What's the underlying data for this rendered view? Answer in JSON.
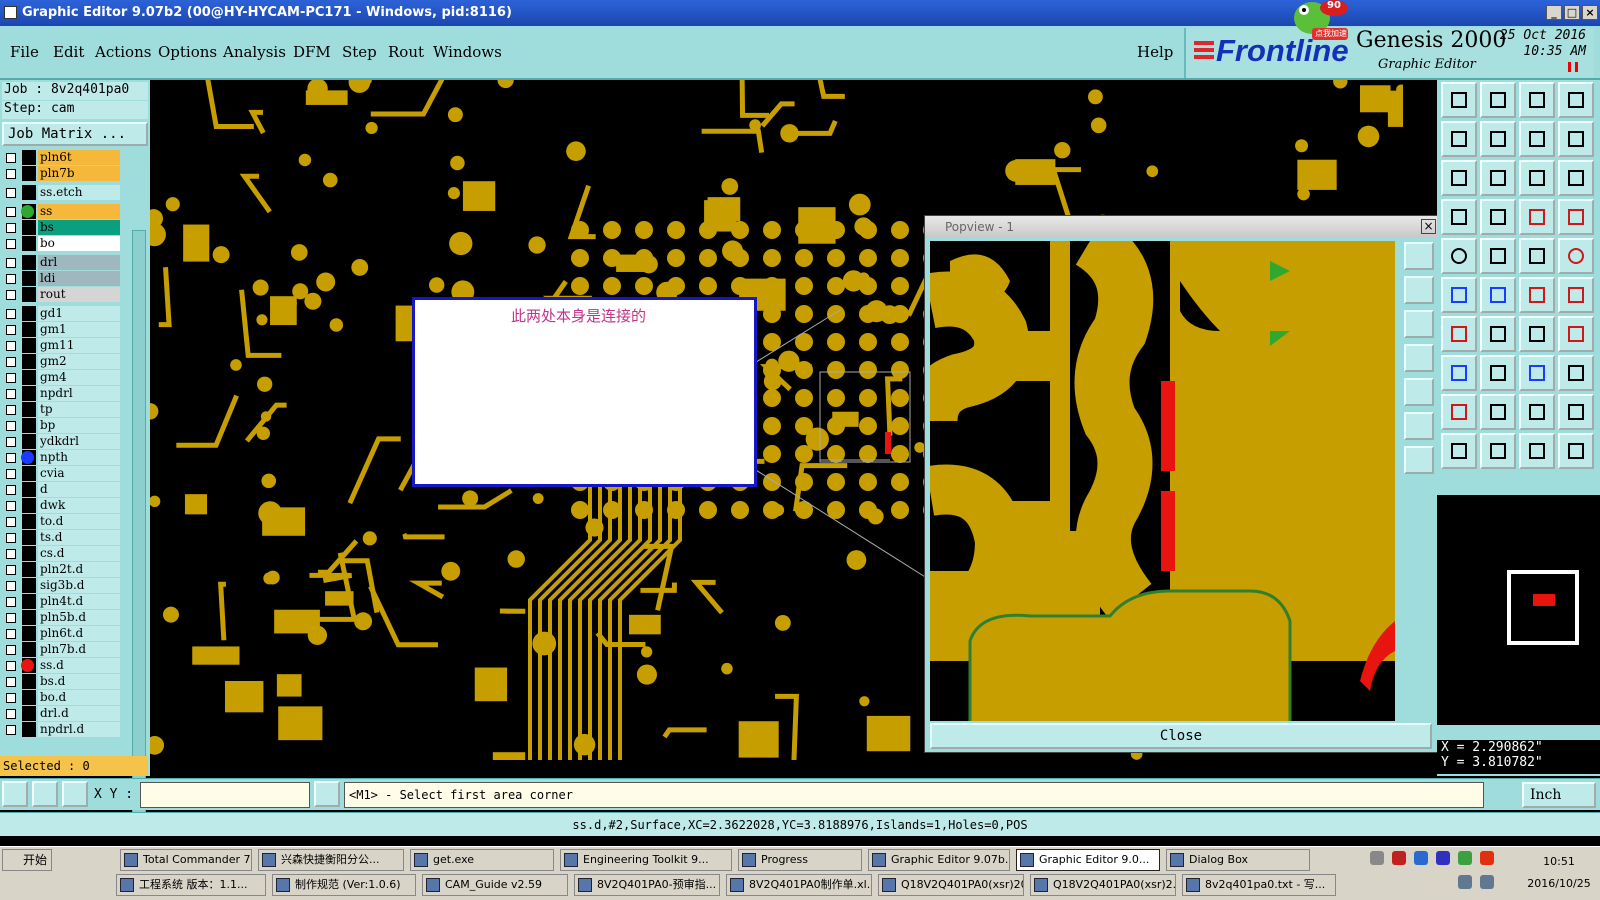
{
  "window": {
    "title": "Graphic Editor 9.07b2 (00@HY-HYCAM-PC171 - Windows, pid:8116)"
  },
  "menu": [
    "File",
    "Edit",
    "Actions",
    "Options",
    "Analysis",
    "DFM",
    "Step",
    "Rout",
    "Windows"
  ],
  "help": "Help",
  "brand": {
    "logo": "Frontline",
    "product": "Genesis 2000",
    "subtitle": "Graphic Editor",
    "date": "25 Oct 2016",
    "time": "10:35 AM",
    "badge": "90",
    "badge_text": "点我加速"
  },
  "job": {
    "job": "Job : 8v2q401pa0",
    "step": "Step: cam",
    "matrix_button": "Job Matrix ..."
  },
  "layers": [
    {
      "name": "pln6t",
      "color": "#f5b83a",
      "dot": ""
    },
    {
      "name": "pln7b",
      "color": "#f5b83a",
      "dot": ""
    },
    {
      "name": "ss.etch",
      "color": "#bfeaea",
      "dot": ""
    },
    {
      "name": "ss",
      "color": "#f5b83a",
      "dot": "#2fa82f"
    },
    {
      "name": "bs",
      "color": "#0a9f7f",
      "dot": ""
    },
    {
      "name": "bo",
      "color": "#ffffff",
      "dot": ""
    },
    {
      "name": "drl",
      "color": "#9fb8bf",
      "dot": ""
    },
    {
      "name": "ldi",
      "color": "#9fb8bf",
      "dot": ""
    },
    {
      "name": "rout",
      "color": "#d5d5d5",
      "dot": ""
    },
    {
      "name": "gd1",
      "color": "#bfeaea",
      "dot": ""
    },
    {
      "name": "gm1",
      "color": "#bfeaea",
      "dot": ""
    },
    {
      "name": "gm11",
      "color": "#bfeaea",
      "dot": ""
    },
    {
      "name": "gm2",
      "color": "#bfeaea",
      "dot": ""
    },
    {
      "name": "gm4",
      "color": "#bfeaea",
      "dot": ""
    },
    {
      "name": "npdrl",
      "color": "#bfeaea",
      "dot": ""
    },
    {
      "name": "tp",
      "color": "#bfeaea",
      "dot": ""
    },
    {
      "name": "bp",
      "color": "#bfeaea",
      "dot": ""
    },
    {
      "name": "ydkdrl",
      "color": "#bfeaea",
      "dot": ""
    },
    {
      "name": "npth",
      "color": "#bfeaea",
      "dot": "#1a3cff"
    },
    {
      "name": "cvia",
      "color": "#bfeaea",
      "dot": ""
    },
    {
      "name": "d",
      "color": "#bfeaea",
      "dot": ""
    },
    {
      "name": "dwk",
      "color": "#bfeaea",
      "dot": ""
    },
    {
      "name": "to.d",
      "color": "#bfeaea",
      "dot": ""
    },
    {
      "name": "ts.d",
      "color": "#bfeaea",
      "dot": ""
    },
    {
      "name": "cs.d",
      "color": "#bfeaea",
      "dot": ""
    },
    {
      "name": "pln2t.d",
      "color": "#bfeaea",
      "dot": ""
    },
    {
      "name": "sig3b.d",
      "color": "#bfeaea",
      "dot": ""
    },
    {
      "name": "pln4t.d",
      "color": "#bfeaea",
      "dot": ""
    },
    {
      "name": "pln5b.d",
      "color": "#bfeaea",
      "dot": ""
    },
    {
      "name": "pln6t.d",
      "color": "#bfeaea",
      "dot": ""
    },
    {
      "name": "pln7b.d",
      "color": "#bfeaea",
      "dot": ""
    },
    {
      "name": "ss.d",
      "color": "#bfeaea",
      "dot": "#e8140f"
    },
    {
      "name": "bs.d",
      "color": "#bfeaea",
      "dot": ""
    },
    {
      "name": "bo.d",
      "color": "#bfeaea",
      "dot": ""
    },
    {
      "name": "drl.d",
      "color": "#bfeaea",
      "dot": ""
    },
    {
      "name": "npdrl.d",
      "color": "#bfeaea",
      "dot": ""
    }
  ],
  "selected": "Selected : 0",
  "note": "此两处本身是连接的",
  "popview": {
    "title": "Popview - 1",
    "close_label": "Close"
  },
  "coords": {
    "x": "X = 2.290862\"",
    "y": "Y = 3.810782\""
  },
  "command": {
    "xy_label": "X Y :",
    "xy_value": "",
    "prompt": "<M1> - Select first area corner",
    "units": "Inch"
  },
  "status": "ss.d,#2,Surface,XC=2.3622028,YC=3.8188976,Islands=1,Holes=0,POS",
  "taskbar": {
    "start": "开始",
    "row1": [
      "Total Commander 7....",
      "兴森快捷衡阳分公...",
      "get.exe",
      "Engineering Toolkit 9...",
      "Progress",
      "Graphic Editor 9.07b...",
      "Graphic Editor 9.0...",
      "Dialog Box"
    ],
    "row2": [
      "工程系统  版本：1.1...",
      "制作规范 (Ver:1.0.6)",
      "CAM_Guide v2.59",
      "8V2Q401PA0-预审指...",
      "8V2Q401PA0制作单.xl...",
      "Q18V2Q401PA0(xsr)20...",
      "Q18V2Q401PA0(xsr)2...",
      "8v2q401pa0.txt - 写..."
    ],
    "clock_time": "10:51",
    "clock_date": "2016/10/25"
  },
  "colors": {
    "copper": "#c69e00",
    "panel": "#9fdcdc",
    "accent_red": "#e8140f",
    "note_text": "#c2338a"
  }
}
